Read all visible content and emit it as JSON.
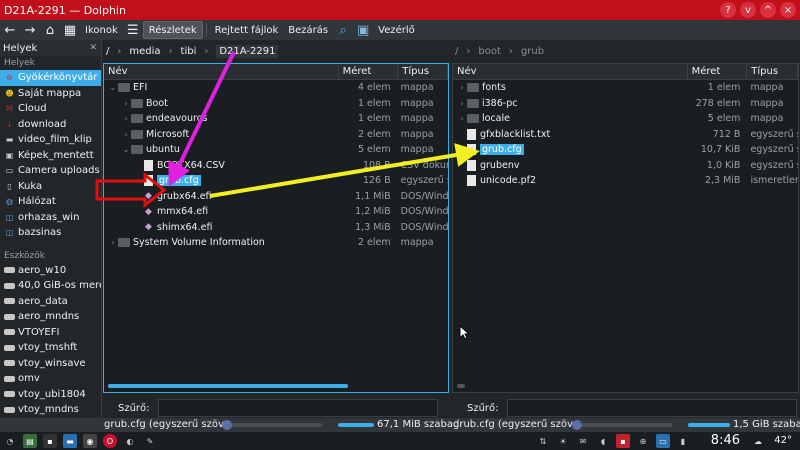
{
  "window": {
    "title": "D21A-2291 — Dolphin",
    "controls": [
      "?",
      "v",
      "^",
      "×"
    ]
  },
  "toolbar": {
    "back_icon": "back-arrow-icon",
    "forward_icon": "forward-arrow-icon",
    "home_icon": "home-icon",
    "items": [
      "Ikonok",
      "Részletek",
      "Rejtett fájlok",
      "Bezárás",
      "Vezérlő"
    ]
  },
  "places": {
    "header": "Helyek",
    "section_places": "Helyek",
    "items": [
      "Gyökérkönyvtár",
      "Saját mappa",
      "Cloud",
      "download",
      "video_film_klip",
      "Képek_mentett",
      "Camera uploads",
      "Kuka",
      "Hálózat",
      "orhazas_win",
      "bazsinas"
    ],
    "section_devices": "Eszközök",
    "devices": [
      "aero_w10",
      "40,0 GiB-os merevl",
      "aero_data",
      "aero_mndns",
      "VTOYEFI",
      "vtoy_tmshft",
      "vtoy_winsave",
      "omv",
      "vtoy_ubi1804",
      "vtoy_mndns"
    ]
  },
  "left": {
    "breadcrumb": [
      "/",
      "media",
      "tibi",
      "D21A-2291"
    ],
    "cols": [
      "Név",
      "Méret",
      "Típus"
    ],
    "rows": [
      {
        "name": "EFI",
        "size": "4 elem",
        "type": "mappa"
      },
      {
        "name": "Boot",
        "size": "1 elem",
        "type": "mappa"
      },
      {
        "name": "endeavouros",
        "size": "1 elem",
        "type": "mappa"
      },
      {
        "name": "Microsoft",
        "size": "2 elem",
        "type": "mappa"
      },
      {
        "name": "ubuntu",
        "size": "5 elem",
        "type": "mappa"
      },
      {
        "name": "BOOTX64.CSV",
        "size": "108 B",
        "type": "CSV dokum"
      },
      {
        "name": "grub.cfg",
        "size": "126 B",
        "type": "egyszerű sz"
      },
      {
        "name": "grubx64.efi",
        "size": "1,1 MiB",
        "type": "DOS/Windo"
      },
      {
        "name": "mmx64.efi",
        "size": "1,2 MiB",
        "type": "DOS/Windo"
      },
      {
        "name": "shimx64.efi",
        "size": "1,3 MiB",
        "type": "DOS/Windo"
      },
      {
        "name": "System Volume Information",
        "size": "2 elem",
        "type": "mappa"
      }
    ],
    "filter_label": "Szűrő:"
  },
  "right": {
    "breadcrumb": [
      "/",
      "boot",
      "grub"
    ],
    "cols": [
      "Név",
      "Méret",
      "Típus"
    ],
    "rows": [
      {
        "name": "fonts",
        "size": "1 elem",
        "type": "mappa"
      },
      {
        "name": "i386-pc",
        "size": "278 elem",
        "type": "mappa"
      },
      {
        "name": "locale",
        "size": "5 elem",
        "type": "mappa"
      },
      {
        "name": "gfxblacklist.txt",
        "size": "712 B",
        "type": "egyszerű sz"
      },
      {
        "name": "grub.cfg",
        "size": "10,7 KiB",
        "type": "egyszerű sz"
      },
      {
        "name": "grubenv",
        "size": "1,0 KiB",
        "type": "egyszerű sz"
      },
      {
        "name": "unicode.pf2",
        "size": "2,3 MiB",
        "type": "ismeretlen"
      }
    ],
    "filter_label": "Szűrő:"
  },
  "status": {
    "left_text": "grub.cfg (egyszerű szöv...",
    "left_free": "67,1 MiB szabad",
    "right_text": "grub.cfg (egyszerű szöv...",
    "right_free": "1,5 GiB szabad"
  },
  "taskbar": {
    "clock": "8:46",
    "temp": "42°"
  },
  "colors": {
    "titlebar": "#c0101c",
    "selection": "#3daee9",
    "arrow_magenta": "#e020e0",
    "arrow_yellow": "#f0f020",
    "arrow_red": "#e01010"
  }
}
